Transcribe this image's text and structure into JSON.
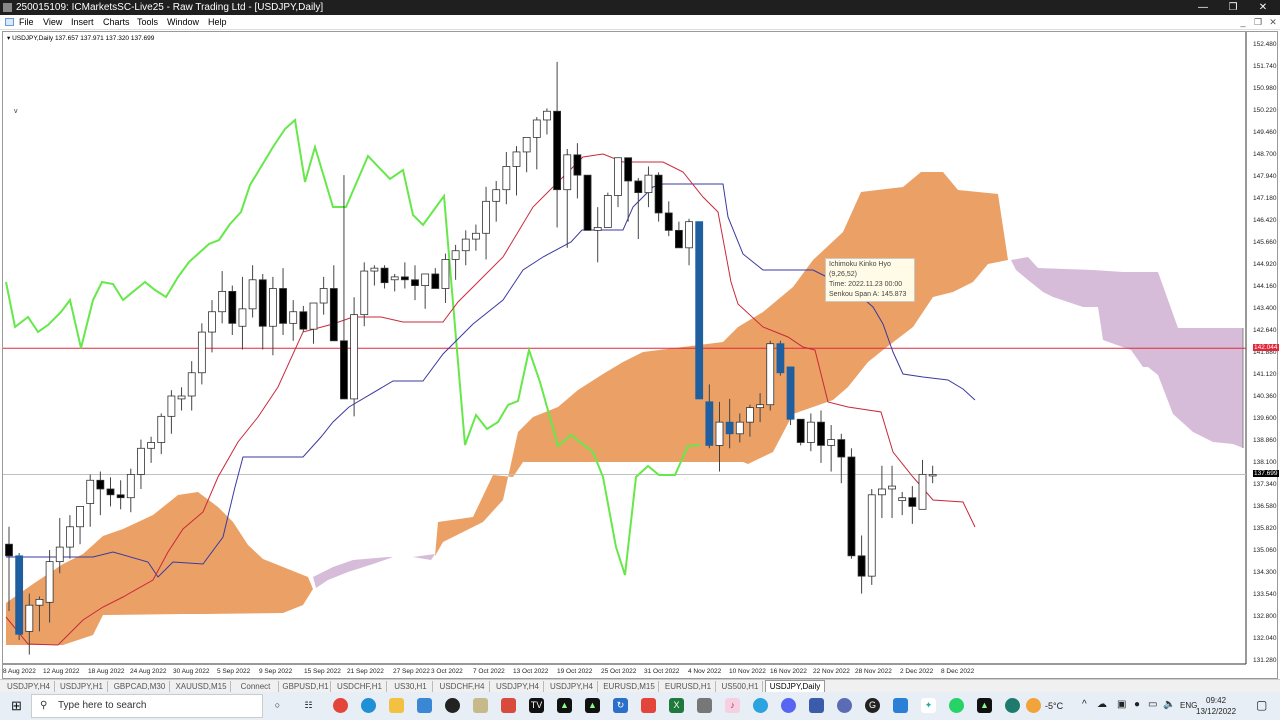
{
  "window": {
    "title": "250015109: ICMarketsSC-Live25 - Raw Trading Ltd - [USDJPY,Daily]",
    "controls": [
      "minimize",
      "maximize",
      "close"
    ]
  },
  "menu": [
    "File",
    "View",
    "Insert",
    "Charts",
    "Tools",
    "Window",
    "Help"
  ],
  "chart": {
    "symbol_info": "USDJPY,Daily  137.657 137.971 137.320 137.699",
    "marker": "v",
    "bid_price": "137.699",
    "hline_price": "142.044",
    "hline_color": "#e0283a",
    "bid_color": "#000000",
    "kumo_bull_color": "#eba066",
    "kumo_bear_color": "#d6bcd9",
    "chikou_color": "#66e84a",
    "tenkan_color": "#c8283c",
    "kijun_color": "#3a3aa0",
    "price_axis": [
      "152.480",
      "151.740",
      "150.980",
      "150.220",
      "149.460",
      "148.700",
      "147.940",
      "147.180",
      "146.420",
      "145.660",
      "144.920",
      "144.160",
      "143.400",
      "142.640",
      "141.880",
      "141.120",
      "140.360",
      "139.600",
      "138.860",
      "138.100",
      "137.340",
      "136.580",
      "135.820",
      "135.060",
      "134.300",
      "133.540",
      "132.800",
      "132.040",
      "131.280"
    ],
    "date_axis": [
      "8 Aug 2022",
      "12 Aug 2022",
      "18 Aug 2022",
      "24 Aug 2022",
      "30 Aug 2022",
      "5 Sep 2022",
      "9 Sep 2022",
      "15 Sep 2022",
      "21 Sep 2022",
      "27 Sep 2022",
      "3 Oct 2022",
      "7 Oct 2022",
      "13 Oct 2022",
      "19 Oct 2022",
      "25 Oct 2022",
      "31 Oct 2022",
      "4 Nov 2022",
      "10 Nov 2022",
      "16 Nov 2022",
      "22 Nov 2022",
      "28 Nov 2022",
      "2 Dec 2022",
      "8 Dec 2022"
    ],
    "tooltip": {
      "line1": "Ichimoku Kinko Hyo",
      "line2": "(9,26,52)",
      "line3": "Time: 2022.11.23 00:00",
      "line4": "Senkou Span A: 145.873"
    }
  },
  "chart_data": {
    "type": "candlestick",
    "title": "USDJPY,Daily",
    "indicator": "Ichimoku Kinko Hyo (9,26,52)",
    "ylim": [
      131.28,
      152.48
    ],
    "candles": [
      [
        135.3,
        135.9,
        133.0,
        134.9
      ],
      [
        134.9,
        135.0,
        132.0,
        132.2
      ],
      [
        132.3,
        133.6,
        131.5,
        133.2
      ],
      [
        133.2,
        133.5,
        132.3,
        133.4
      ],
      [
        133.3,
        135.1,
        132.6,
        134.7
      ],
      [
        134.7,
        136.2,
        134.3,
        135.2
      ],
      [
        135.2,
        136.3,
        134.8,
        135.9
      ],
      [
        135.9,
        136.4,
        135.3,
        136.6
      ],
      [
        136.7,
        137.7,
        135.9,
        137.5
      ],
      [
        137.5,
        137.8,
        136.3,
        137.2
      ],
      [
        137.2,
        137.6,
        136.6,
        137.0
      ],
      [
        137.0,
        137.5,
        136.5,
        136.9
      ],
      [
        136.9,
        137.9,
        136.4,
        137.7
      ],
      [
        137.7,
        138.9,
        137.2,
        138.6
      ],
      [
        138.6,
        139.0,
        138.1,
        138.8
      ],
      [
        138.8,
        139.8,
        138.4,
        139.7
      ],
      [
        139.7,
        140.6,
        139.1,
        140.4
      ],
      [
        140.3,
        140.7,
        139.9,
        140.4
      ],
      [
        140.4,
        141.6,
        139.9,
        141.2
      ],
      [
        141.2,
        142.9,
        140.8,
        142.6
      ],
      [
        142.6,
        143.7,
        141.9,
        143.3
      ],
      [
        143.3,
        144.7,
        142.9,
        144.0
      ],
      [
        144.0,
        144.2,
        142.5,
        142.9
      ],
      [
        142.8,
        144.5,
        142.0,
        143.4
      ],
      [
        143.4,
        144.9,
        143.1,
        144.4
      ],
      [
        144.4,
        144.6,
        142.0,
        142.8
      ],
      [
        142.8,
        144.5,
        141.8,
        144.1
      ],
      [
        144.1,
        144.8,
        142.5,
        142.9
      ],
      [
        142.9,
        143.7,
        142.3,
        143.3
      ],
      [
        143.3,
        143.5,
        142.6,
        142.7
      ],
      [
        142.7,
        143.6,
        142.2,
        143.6
      ],
      [
        143.6,
        144.5,
        143.2,
        144.1
      ],
      [
        144.1,
        144.9,
        143.2,
        142.3
      ],
      [
        142.3,
        148.0,
        140.3,
        140.3
      ],
      [
        140.3,
        143.8,
        139.7,
        143.2
      ],
      [
        143.2,
        145.0,
        142.8,
        144.7
      ],
      [
        144.7,
        144.9,
        144.2,
        144.8
      ],
      [
        144.8,
        144.9,
        144.1,
        144.3
      ],
      [
        144.4,
        144.6,
        144.0,
        144.5
      ],
      [
        144.5,
        145.0,
        144.1,
        144.4
      ],
      [
        144.4,
        144.9,
        143.7,
        144.2
      ],
      [
        144.2,
        144.5,
        143.4,
        144.6
      ],
      [
        144.6,
        144.8,
        144.1,
        144.1
      ],
      [
        144.1,
        145.3,
        143.6,
        145.1
      ],
      [
        145.1,
        145.6,
        144.4,
        145.4
      ],
      [
        145.4,
        146.1,
        144.9,
        145.8
      ],
      [
        145.8,
        146.3,
        145.4,
        146.0
      ],
      [
        146.0,
        147.6,
        145.1,
        147.1
      ],
      [
        147.1,
        147.8,
        146.4,
        147.5
      ],
      [
        147.5,
        148.8,
        147.0,
        148.3
      ],
      [
        148.3,
        149.0,
        147.3,
        148.8
      ],
      [
        148.8,
        149.3,
        148.1,
        149.3
      ],
      [
        149.3,
        150.0,
        148.2,
        149.9
      ],
      [
        149.9,
        150.3,
        149.4,
        150.2
      ],
      [
        150.2,
        151.9,
        146.2,
        147.5
      ],
      [
        147.5,
        148.9,
        145.5,
        148.7
      ],
      [
        148.7,
        149.1,
        147.2,
        148.0
      ],
      [
        148.0,
        147.8,
        146.2,
        146.1
      ],
      [
        146.1,
        146.9,
        145.0,
        146.2
      ],
      [
        146.2,
        147.4,
        146.2,
        147.3
      ],
      [
        147.3,
        148.6,
        146.9,
        148.6
      ],
      [
        148.6,
        148.6,
        146.4,
        147.8
      ],
      [
        147.8,
        147.9,
        145.8,
        147.4
      ],
      [
        147.4,
        148.3,
        146.9,
        148.0
      ],
      [
        148.0,
        148.1,
        146.4,
        146.7
      ],
      [
        146.7,
        147.1,
        145.9,
        146.1
      ],
      [
        146.1,
        146.4,
        145.5,
        145.5
      ],
      [
        145.5,
        146.5,
        144.9,
        146.4
      ],
      [
        146.4,
        145.9,
        141.0,
        140.3
      ],
      [
        140.2,
        140.8,
        138.6,
        138.7
      ],
      [
        138.7,
        140.2,
        137.8,
        139.5
      ],
      [
        139.5,
        140.3,
        138.6,
        139.1
      ],
      [
        139.1,
        139.8,
        138.8,
        139.5
      ],
      [
        139.5,
        140.1,
        139.0,
        140.0
      ],
      [
        140.0,
        140.5,
        139.5,
        140.1
      ],
      [
        140.1,
        142.3,
        139.9,
        142.2
      ],
      [
        142.2,
        142.3,
        141.1,
        141.2
      ],
      [
        141.4,
        141.0,
        139.4,
        139.6
      ],
      [
        139.6,
        139.6,
        138.7,
        138.8
      ],
      [
        138.8,
        139.8,
        138.5,
        139.5
      ],
      [
        139.5,
        139.9,
        138.1,
        138.7
      ],
      [
        138.7,
        139.4,
        137.8,
        138.9
      ],
      [
        138.9,
        139.1,
        137.4,
        138.3
      ],
      [
        138.3,
        138.6,
        134.8,
        134.9
      ],
      [
        134.9,
        135.6,
        133.6,
        134.2
      ],
      [
        134.2,
        137.2,
        133.9,
        137.0
      ],
      [
        137.0,
        138.0,
        136.2,
        137.2
      ],
      [
        137.2,
        138.0,
        136.2,
        137.3
      ],
      [
        136.8,
        137.1,
        136.3,
        136.9
      ],
      [
        136.9,
        137.3,
        136.0,
        136.6
      ],
      [
        136.5,
        138.2,
        136.6,
        137.7
      ],
      [
        137.7,
        138.0,
        137.4,
        137.7
      ]
    ],
    "blue_candle_indices": [
      1,
      68,
      69,
      71,
      76,
      77
    ]
  },
  "tabs": [
    "USDJPY,H4",
    "USDJPY,H1",
    "GBPCAD,M30",
    "XAUUSD,M15",
    "Connect",
    "GBPUSD,H1",
    "USDCHF,H1",
    "US30,H1",
    "USDCHF,H4",
    "USDJPY,H4",
    "USDJPY,H4",
    "EURUSD,M15",
    "EURUSD,H1",
    "US500,H1",
    "USDJPY,Daily"
  ],
  "active_tab": "USDJPY,Daily",
  "taskbar": {
    "search_placeholder": "Type here to search",
    "weather": "-5°C",
    "lang": "ENG",
    "time": "09:42",
    "date": "13/12/2022"
  }
}
